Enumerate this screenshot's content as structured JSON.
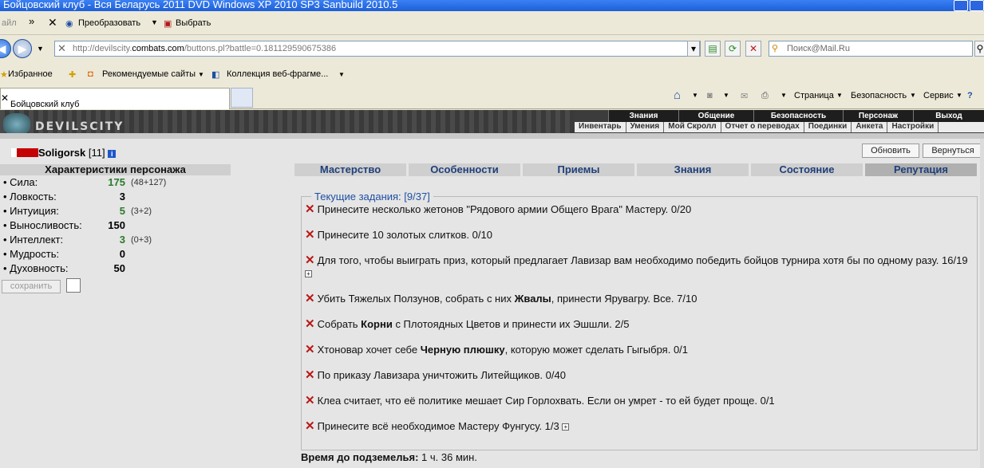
{
  "window": {
    "title": "Бойцовский клуб - Вся Беларусь 2011 DVD Windows XP 2010 SP3 Sanbuild 2010.5"
  },
  "menubar": {
    "file_fragment": "айл",
    "convert": "Преобразовать",
    "select": "Выбрать"
  },
  "address": {
    "url_prefix": "http://devilscity.",
    "url_domain": "combats.com",
    "url_suffix": "/buttons.pl?battle=0.181129590675386",
    "search_placeholder": "Поиск@Mail.Ru"
  },
  "favorites": {
    "favorites": "Избранное",
    "recommended": "Рекомендуемые сайты",
    "gallery": "Коллекция веб-фрагме..."
  },
  "tab": {
    "title": "Бойцовский клуб"
  },
  "commandbar": {
    "page": "Страница",
    "security": "Безопасность",
    "tools": "Сервис"
  },
  "game": {
    "logo": "DEVILSCITY",
    "topnav": [
      "Знания",
      "Общение",
      "Безопасность",
      "Персонаж",
      "Выход"
    ],
    "subnav": [
      "Инвентарь",
      "Умения",
      "Мой Скролл",
      "Отчет о переводах",
      "Поединки",
      "Анкета",
      "Настройки"
    ]
  },
  "character": {
    "name": "Soligorsk",
    "level": "[11]"
  },
  "buttons": {
    "refresh": "Обновить",
    "back": "Вернуться"
  },
  "stats_panel": {
    "title": "Характеристики персонажа",
    "stats": [
      {
        "label": "• Сила:",
        "value": "175",
        "bonus": "(48+127)",
        "color": "green"
      },
      {
        "label": "• Ловкость:",
        "value": "3",
        "bonus": ""
      },
      {
        "label": "• Интуиция:",
        "value": "5",
        "bonus": "(3+2)",
        "color": "green"
      },
      {
        "label": "• Выносливость:",
        "value": "150",
        "bonus": ""
      },
      {
        "label": "• Интеллект:",
        "value": "3",
        "bonus": "(0+3)",
        "color": "green"
      },
      {
        "label": "• Мудрость:",
        "value": "0",
        "bonus": ""
      },
      {
        "label": "• Духовность:",
        "value": "50",
        "bonus": ""
      }
    ],
    "save": "сохранить"
  },
  "tabs": [
    "Мастерство",
    "Особенности",
    "Приемы",
    "Знания",
    "Состояние",
    "Репутация"
  ],
  "active_tab": "Репутация",
  "quests": {
    "legend": "Текущие задания: [9/37]",
    "items": [
      {
        "text": "Принесите несколько жетонов \"Рядового армии Общего Врага\" Мастеру. 0/20"
      },
      {
        "text": "Принесите 10 золотых слитков. 0/10"
      },
      {
        "text": "Для того, чтобы выиграть приз, который предлагает Лавизар вам необходимо победить бойцов турнира хотя бы по одному разу. 16/19",
        "expand": true
      },
      {
        "pre": "Убить Тяжелых Ползунов, собрать с них ",
        "bold": "Жвалы",
        "post": ", принести Ярувагру. Все. 7/10"
      },
      {
        "pre": "Собрать ",
        "bold": "Корни",
        "post": " с Плотоядных Цветов и принести их Эшшли. 2/5"
      },
      {
        "pre": "Хтоновар хочет себе ",
        "bold": "Черную плюшку",
        "post": ", которую может сделать Гыгыбря. 0/1"
      },
      {
        "text": "По приказу Лавизара уничтожить Литейщиков. 0/40"
      },
      {
        "text": "Клеа считает, что её политике мешает Сир Горлохвать. Если он умрет - то ей будет проще. 0/1"
      },
      {
        "text": "Принесите всё необходимое Мастеру Фунгусу. 1/3",
        "expand": true
      }
    ]
  },
  "dungeon": {
    "label": "Время до подземелья:",
    "value": "1 ч. 36 мин."
  },
  "icons": [
    "search-icon",
    "refresh-icon",
    "stop-icon",
    "home-icon",
    "rss-icon",
    "print-icon",
    "help-icon",
    "star-icon",
    "close-icon"
  ]
}
